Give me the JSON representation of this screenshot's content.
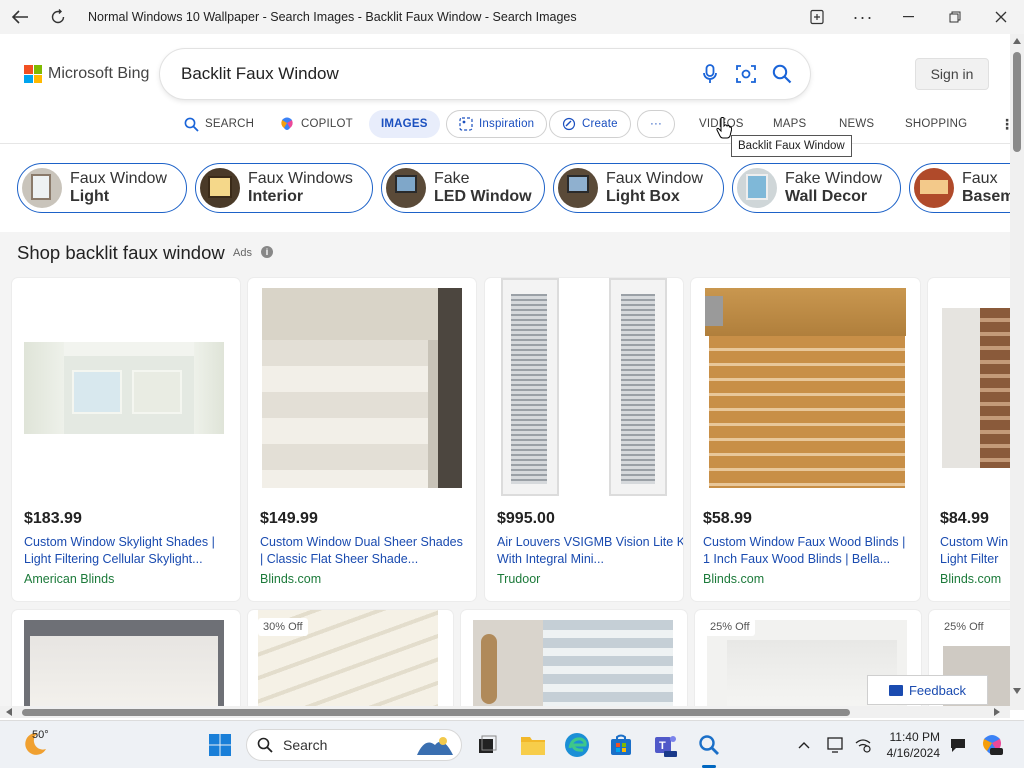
{
  "window": {
    "title": "Normal Windows 10 Wallpaper - Search Images - Backlit Faux Window - Search Images"
  },
  "bing": {
    "logo_text": "Microsoft Bing",
    "query": "Backlit Faux Window",
    "signin_label": "Sign in"
  },
  "nav": {
    "search": "SEARCH",
    "copilot": "COPILOT",
    "images": "IMAGES",
    "inspiration": "Inspiration",
    "create": "Create",
    "more": "···",
    "videos": "VIDEOS",
    "maps": "MAPS",
    "news": "NEWS",
    "shopping": "SHOPPING"
  },
  "tooltip": "Backlit Faux Window",
  "chips": [
    {
      "line1": "Faux Window",
      "line2": "Light"
    },
    {
      "line1": "Faux Windows",
      "line2": "Interior"
    },
    {
      "line1": "Fake",
      "line2": "LED Window"
    },
    {
      "line1": "Faux Window",
      "line2": "Light Box"
    },
    {
      "line1": "Fake Window",
      "line2": "Wall Decor"
    },
    {
      "line1": "Faux",
      "line2": "Basem"
    }
  ],
  "shop": {
    "title": "Shop backlit faux window",
    "ads_label": "Ads",
    "products": [
      {
        "price": "$183.99",
        "title": "Custom Window Skylight Shades | Light Filtering Cellular Skylight...",
        "seller": "American Blinds"
      },
      {
        "price": "$149.99",
        "title": "Custom Window Dual Sheer Shades | Classic Flat Sheer Shade...",
        "seller": "Blinds.com"
      },
      {
        "price": "$995.00",
        "title": "Air Louvers VSIGMB Vision Lite Kit With Integral Mini...",
        "seller": "Trudoor"
      },
      {
        "price": "$58.99",
        "title": "Custom Window Faux Wood Blinds | 1 Inch Faux Wood Blinds | Bella...",
        "seller": "Blinds.com"
      },
      {
        "price": "$84.99",
        "title": "Custom Win | Light Filter",
        "seller": "Blinds.com"
      }
    ],
    "row2_badges": [
      "30% Off",
      "25% Off",
      "25% Off"
    ]
  },
  "feedback_label": "Feedback",
  "taskbar": {
    "temperature": "50°",
    "search_label": "Search",
    "time": "11:40 PM",
    "date": "4/16/2024"
  }
}
